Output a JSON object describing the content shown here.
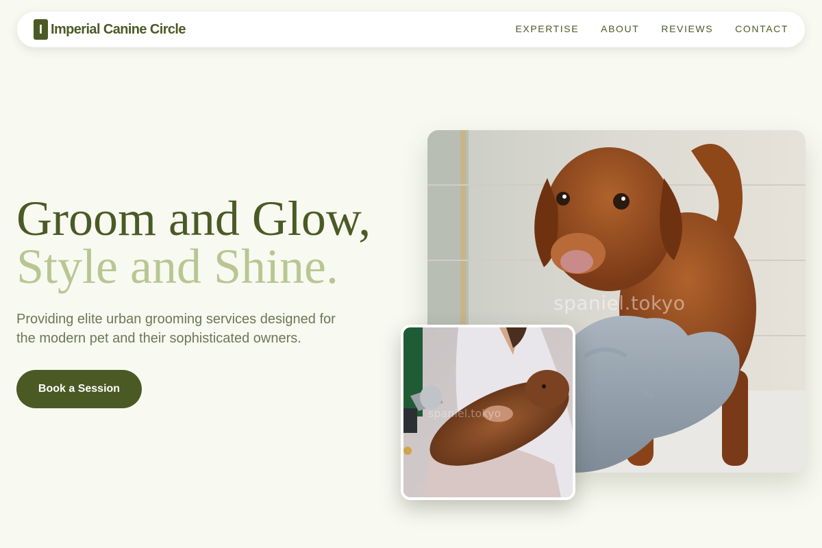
{
  "brand": {
    "mark": "I",
    "name": "Imperial Canine Circle"
  },
  "nav": {
    "items": [
      {
        "label": "EXPERTISE"
      },
      {
        "label": "ABOUT"
      },
      {
        "label": "REVIEWS"
      },
      {
        "label": "CONTACT"
      }
    ]
  },
  "hero": {
    "title_line1": "Groom and Glow,",
    "title_line2": "Style and Shine.",
    "subtitle": "Providing elite urban grooming services designed for the modern pet and their sophisticated owners.",
    "cta_label": "Book a Session"
  },
  "images": {
    "main_watermark": "spaniel.tokyo",
    "small_watermark": "spaniel.tokyo"
  },
  "colors": {
    "brand": "#4b5a25",
    "accent_light": "#b9c693",
    "text_muted": "#6d7757",
    "background": "#f8f9f1"
  }
}
